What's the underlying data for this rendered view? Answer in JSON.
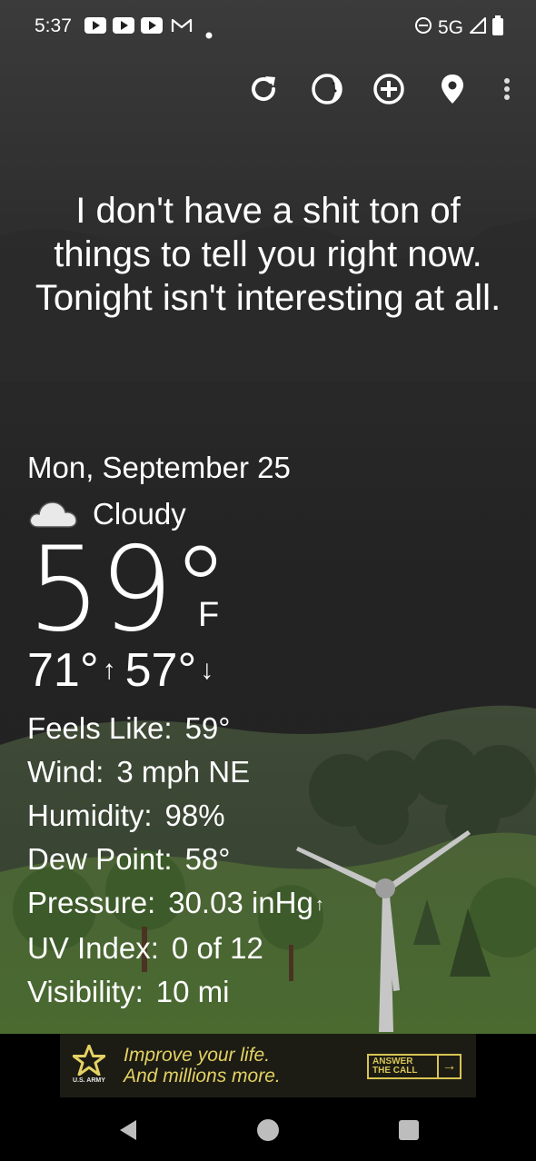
{
  "status_bar": {
    "time": "5:37",
    "network": "5G",
    "notification_icons": [
      "youtube-icon",
      "youtube-icon",
      "youtube-icon",
      "gmail-icon",
      "dot-icon"
    ]
  },
  "toolbar": {
    "icons": [
      "refresh-icon",
      "moon-phase-icon",
      "add-location-icon",
      "location-pin-icon",
      "more-vert-icon"
    ]
  },
  "headline": "I don't have a shit ton of things to tell you right now. Tonight isn't interesting at all.",
  "weather": {
    "date": "Mon, September 25",
    "condition": "Cloudy",
    "condition_icon": "cloud-icon",
    "temperature": "59°",
    "unit": "F",
    "high": "71°",
    "low": "57°",
    "high_arrow": "↑",
    "low_arrow": "↓"
  },
  "details": {
    "feels_like_label": "Feels Like:",
    "feels_like_value": "59°",
    "wind_label": "Wind:",
    "wind_value": "3 mph NE",
    "humidity_label": "Humidity:",
    "humidity_value": "98%",
    "dew_point_label": "Dew Point:",
    "dew_point_value": "58°",
    "pressure_label": "Pressure:",
    "pressure_value": "30.03 inHg",
    "pressure_trend": "↑",
    "uv_label": "UV Index:",
    "uv_value": "0 of 12",
    "visibility_label": "Visibility:",
    "visibility_value": "10 mi"
  },
  "ad": {
    "brand": "U.S. ARMY",
    "line1": "Improve your life.",
    "line2": "And millions more.",
    "cta_line1": "ANSWER",
    "cta_line2": "THE CALL",
    "cta_arrow": "→",
    "accent_color": "#e4d163"
  },
  "nav_bar": {
    "buttons": [
      "back-icon",
      "home-icon",
      "recents-icon"
    ]
  }
}
